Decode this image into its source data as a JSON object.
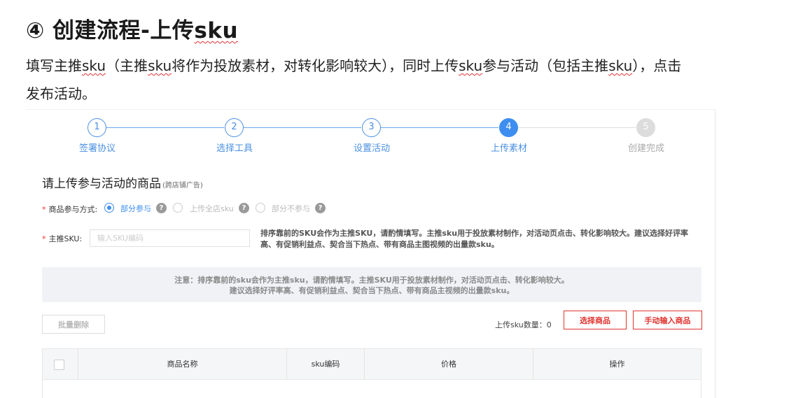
{
  "heading": {
    "circle_number": "④",
    "title_before": "创建流程-上传",
    "title_uw": "sku"
  },
  "description": {
    "p1": "填写主推",
    "sku1": "sku",
    "p2": "（主推",
    "sku2": "sku",
    "p3": "将作为投放素材，对转化影响较大），同时上传",
    "sku3": "sku",
    "p4": "参与活动（包括主推",
    "sku4": "sku",
    "p5": "），点击",
    "line2": "发布活动。"
  },
  "steps": [
    {
      "num": "1",
      "label": "签署协议",
      "state": "done"
    },
    {
      "num": "2",
      "label": "选择工具",
      "state": "done"
    },
    {
      "num": "3",
      "label": "设置活动",
      "state": "done"
    },
    {
      "num": "4",
      "label": "上传素材",
      "state": "active"
    },
    {
      "num": "5",
      "label": "创建完成",
      "state": "todo"
    }
  ],
  "section": {
    "title": "请上传参与活动的商品",
    "subtitle": "(跨店铺广告)"
  },
  "form": {
    "mode_label": "商品参与方式:",
    "mode_options": [
      {
        "label": "部分参与",
        "selected": true
      },
      {
        "label": "上传全店sku",
        "selected": false
      },
      {
        "label": "部分不参与",
        "selected": false
      }
    ],
    "help_glyph": "?",
    "sku_label": "主推SKU:",
    "sku_value": "",
    "sku_placeholder": "输入SKU编码",
    "sku_hint": "排序靠前的SKU会作为主推SKU，请酌情填写。主推sku用于投放素材制作，对活动页点击、转化影响较大。建议选择好评率高、有促销利益点、契合当下热点、带有商品主图视频的出量款sku。"
  },
  "notice": {
    "line1": "注意：排序靠前的sku会作为主推sku，请酌情填写。主推SKU用于投放素材制作，对活动页点击、转化影响较大。",
    "line2": "建议选择好评率高、有促销利益点、契合当下热点、带有商品主视频的出量款sku。"
  },
  "toolbar": {
    "batch_delete": "批量删除",
    "count_label": "上传sku数量：",
    "count_value": "0",
    "select_goods": "选择商品",
    "manual_input": "手动输入商品"
  },
  "table": {
    "columns": [
      "商品名称",
      "sku编码",
      "价格",
      "操作"
    ]
  },
  "colors": {
    "accent": "#3d8ef0",
    "danger": "#e0342f",
    "required": "#e33"
  }
}
